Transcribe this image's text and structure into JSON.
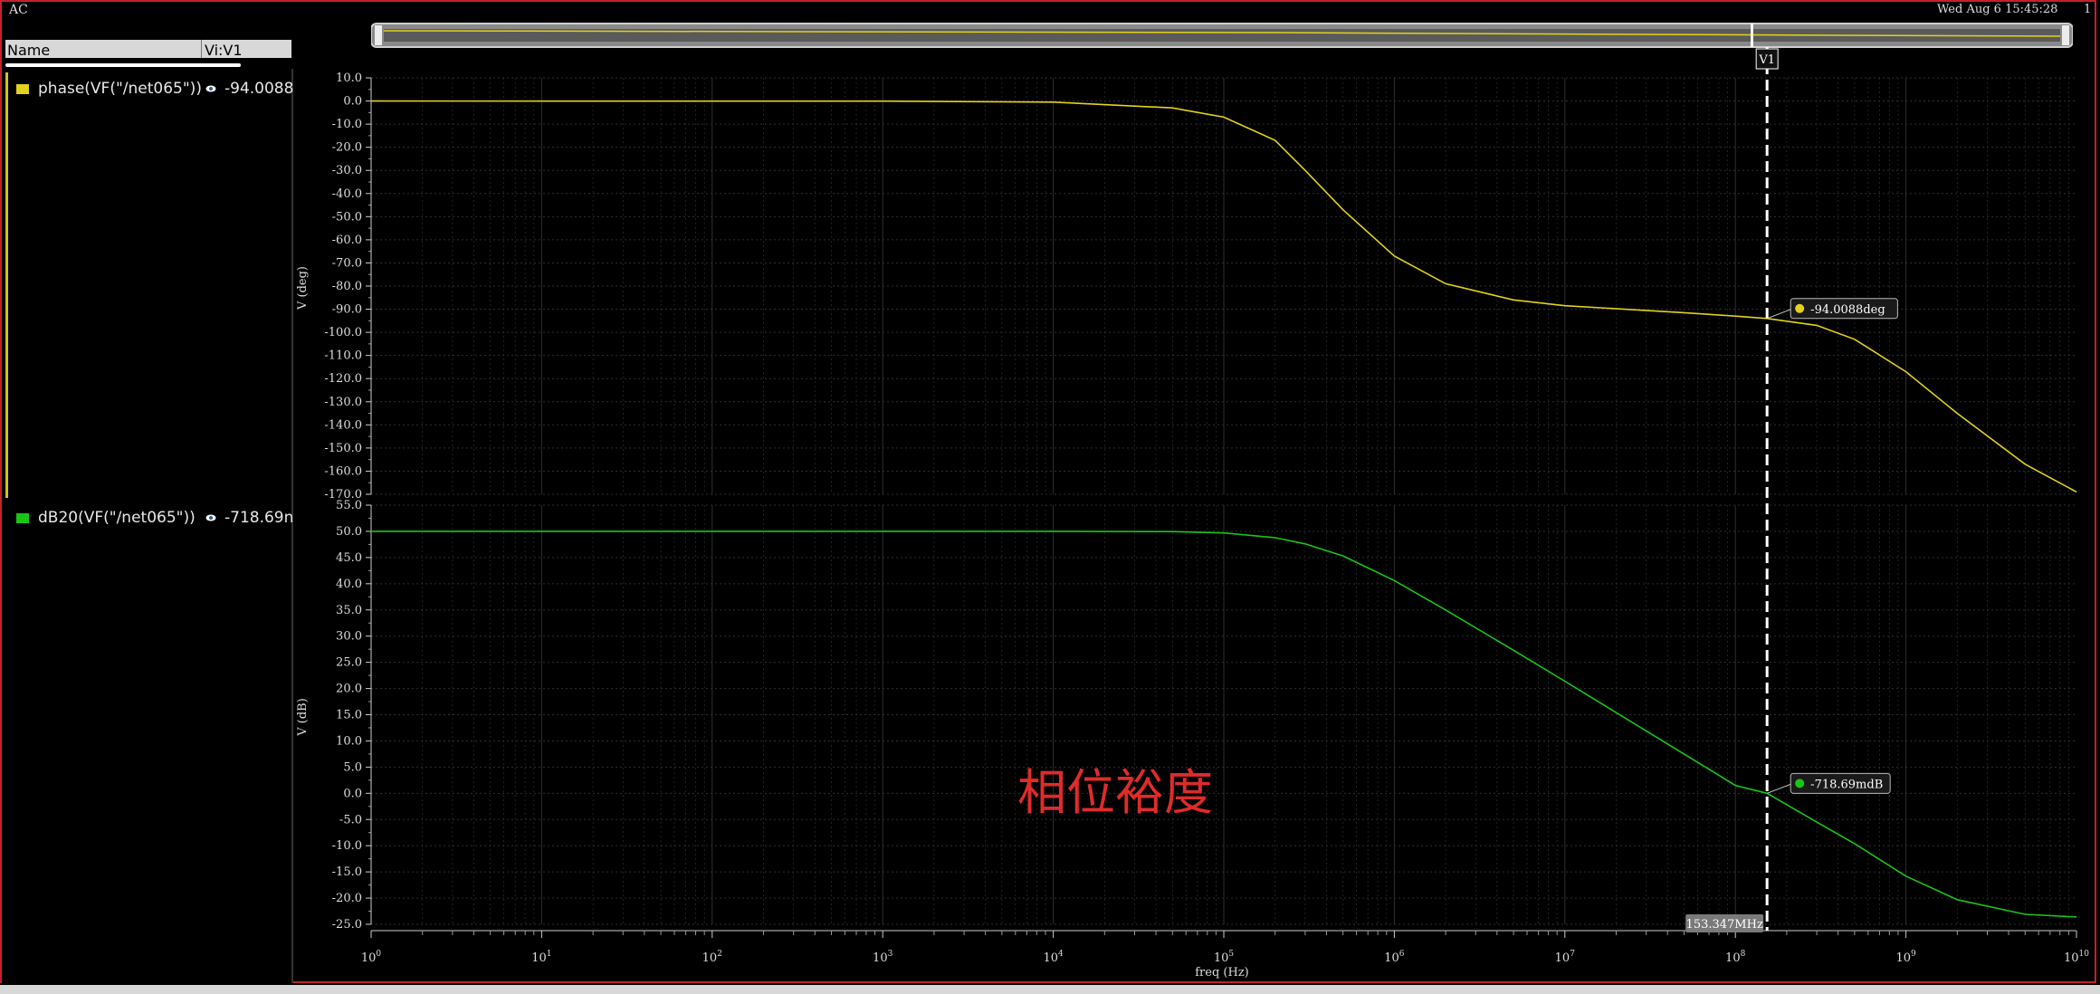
{
  "window": {
    "title": "AC",
    "datetime": "Wed Aug 6 15:45:28",
    "page_number": "1"
  },
  "trace_list": {
    "name_header": "Name",
    "value_header": "Vi:V1",
    "traces": [
      {
        "name": "phase(VF(\"/net065\"))",
        "value": "-94.0088",
        "color": "#e3d11d",
        "icon": "eye-icon"
      },
      {
        "name": "dB20(VF(\"/net065\"))",
        "value": "-718.69n",
        "color": "#19c519",
        "icon": "eye-icon"
      }
    ]
  },
  "cursor": {
    "name": "V1",
    "x_readout": "153.347MHz",
    "x_value": 153347000,
    "color": "#ffffff"
  },
  "colors": {
    "phase": "#e3d11d",
    "gain": "#19c519",
    "grid": "#2e2e2e",
    "annotation": "#e02b2b",
    "frame": "#c2222a"
  },
  "annotation_text": "相位裕度",
  "chart_data": [
    {
      "type": "line",
      "title": "",
      "xlabel": "freq (Hz)",
      "ylabel": "V (deg)",
      "x_scale": "log",
      "xlim": [
        1,
        10000000000
      ],
      "ylim": [
        -170,
        10
      ],
      "y_ticks": [
        10,
        0,
        -10,
        -20,
        -30,
        -40,
        -50,
        -60,
        -70,
        -80,
        -90,
        -100,
        -110,
        -120,
        -130,
        -140,
        -150,
        -160,
        -170
      ],
      "y_tick_labels": [
        "10.0",
        "0.0",
        "-10.0",
        "-20.0",
        "-30.0",
        "-40.0",
        "-50.0",
        "-60.0",
        "-70.0",
        "-80.0",
        "-90.0",
        "-100.0",
        "-110.0",
        "-120.0",
        "-130.0",
        "-140.0",
        "-150.0",
        "-160.0",
        "-170.0"
      ],
      "grid": true,
      "series": [
        {
          "name": "phase(VF(\"/net065\"))",
          "x": [
            1,
            1000,
            10000,
            50000,
            100000,
            200000,
            300000,
            500000,
            1000000,
            2000000,
            5000000,
            10000000,
            50000000,
            100000000,
            153347000,
            300000000,
            500000000,
            1000000000,
            2000000000,
            5000000000,
            10000000000
          ],
          "y": [
            0,
            -0.05,
            -0.5,
            -3,
            -7,
            -17,
            -30,
            -47,
            -67,
            -79,
            -86,
            -88.5,
            -91.5,
            -93,
            -94.0088,
            -97,
            -103,
            -117,
            -135,
            -157,
            -169
          ]
        }
      ],
      "marker": {
        "label": "-94.0088deg",
        "x": 153347000,
        "y": -94.0088
      }
    },
    {
      "type": "line",
      "title": "",
      "xlabel": "freq (Hz)",
      "ylabel": "V (dB)",
      "x_scale": "log",
      "xlim": [
        1,
        10000000000
      ],
      "ylim": [
        -25,
        55
      ],
      "x_ticks": [
        1,
        10,
        100,
        1000,
        10000,
        100000,
        1000000,
        10000000,
        100000000,
        1000000000,
        10000000000
      ],
      "x_tick_exponents": [
        "0",
        "1",
        "2",
        "3",
        "4",
        "5",
        "6",
        "7",
        "8",
        "9",
        "10"
      ],
      "y_ticks": [
        55,
        50,
        45,
        40,
        35,
        30,
        25,
        20,
        15,
        10,
        5,
        0,
        -5,
        -10,
        -15,
        -20,
        -25
      ],
      "y_tick_labels": [
        "55.0",
        "50.0",
        "45.0",
        "40.0",
        "35.0",
        "30.0",
        "25.0",
        "20.0",
        "15.0",
        "10.0",
        "5.0",
        "0.0",
        "-5.0",
        "-10.0",
        "-15.0",
        "-20.0",
        "-25.0"
      ],
      "grid": true,
      "series": [
        {
          "name": "dB20(VF(\"/net065\"))",
          "x": [
            1,
            10000,
            50000,
            100000,
            200000,
            300000,
            500000,
            1000000,
            2000000,
            5000000,
            10000000,
            50000000,
            100000000,
            153347000,
            300000000,
            500000000,
            1000000000,
            2000000000,
            5000000000,
            10000000000
          ],
          "y": [
            50,
            50,
            49.95,
            49.7,
            48.8,
            47.6,
            45.3,
            40.6,
            35,
            27.3,
            21.4,
            7.5,
            1.5,
            -0.000718,
            -5.5,
            -9.6,
            -15.8,
            -20.3,
            -23.1,
            -23.6
          ]
        }
      ],
      "marker": {
        "label": "-718.69mdB",
        "x": 153347000,
        "y": -0.000718
      }
    }
  ]
}
